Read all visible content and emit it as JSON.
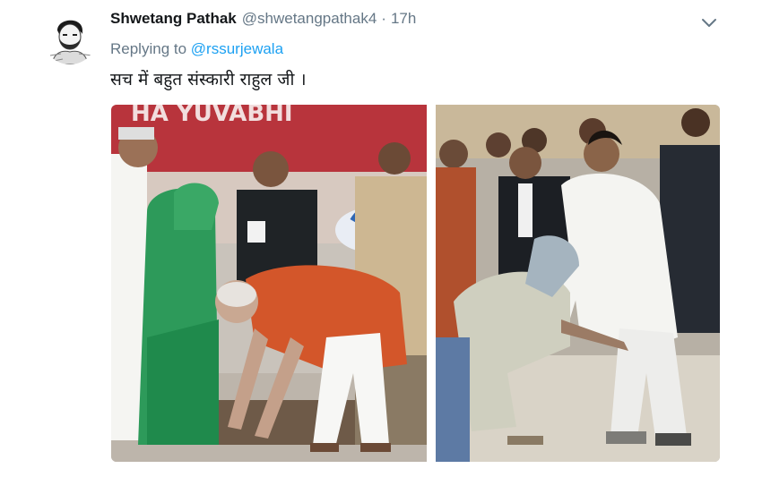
{
  "tweet": {
    "display_name": "Shwetang Pathak",
    "handle": "@shwetangpathak4",
    "separator": "·",
    "time": "17h",
    "replying_label": "Replying to",
    "replying_to": "@rssurjewala",
    "text": "सच में बहुत संस्कारी राहुल जी ।",
    "banner_text": "HA YUVABHI"
  },
  "icons": {
    "caret": "chevron-down-icon",
    "avatar": "avatar-sketch"
  },
  "colors": {
    "name": "#14171a",
    "secondary": "#657786",
    "link": "#1da1f2"
  }
}
